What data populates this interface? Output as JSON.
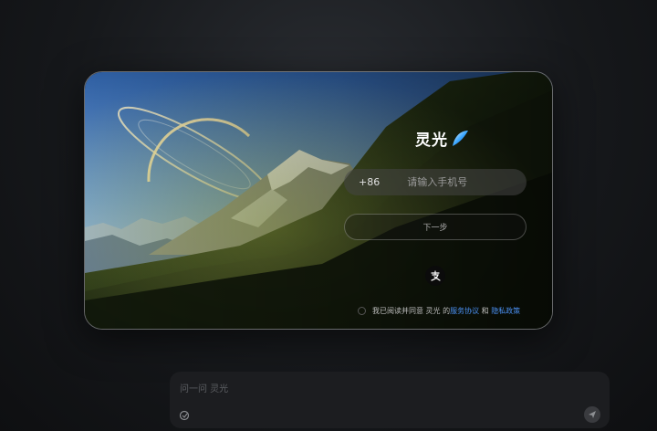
{
  "login": {
    "brand": "灵光",
    "country_code": "+86",
    "phone_placeholder": "请输入手机号",
    "next_label": "下一步",
    "alt_login_icon": "alipay-icon",
    "agreement": {
      "prefix": "我已阅读并同意 灵光 的 ",
      "terms_link": "服务协议",
      "conjunction": " 和 ",
      "privacy_link": "隐私政策"
    }
  },
  "chat": {
    "placeholder": "问一问 灵光",
    "attach_icon": "attach-icon",
    "send_icon": "send-icon"
  },
  "colors": {
    "accent": "#4a8ff0",
    "background": "#16181b"
  }
}
